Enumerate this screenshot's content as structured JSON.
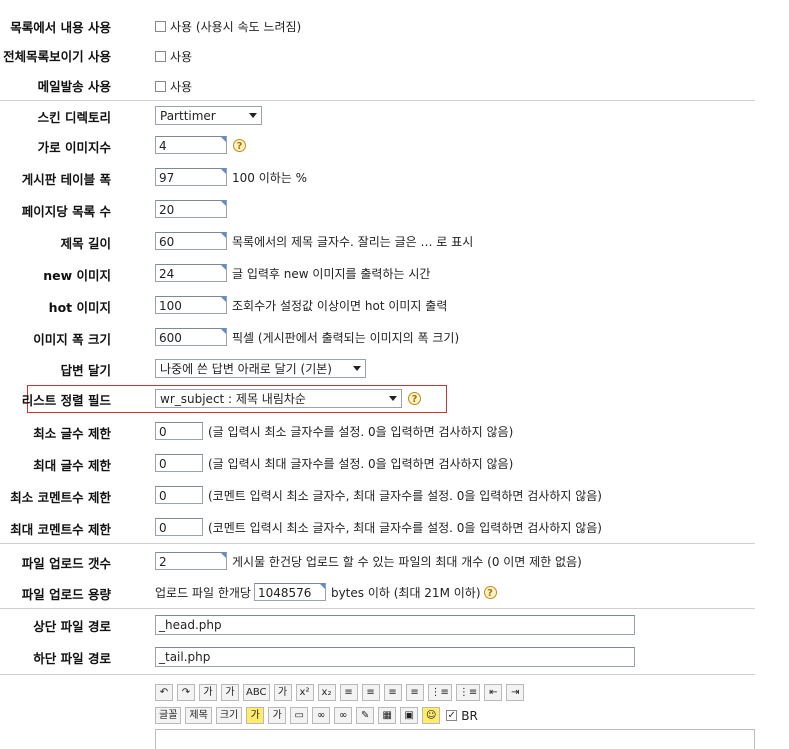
{
  "rows": {
    "list_content": {
      "label": "목록에서 내용 사용",
      "option": "사용 (사용시 속도 느려짐)"
    },
    "full_list": {
      "label": "전체목록보이기 사용",
      "option": "사용"
    },
    "mail_send": {
      "label": "메일발송 사용",
      "option": "사용"
    },
    "skin_dir": {
      "label": "스킨 디렉토리",
      "selected": "Parttimer"
    },
    "horiz_images": {
      "label": "가로 이미지수",
      "value": "4"
    },
    "table_width": {
      "label": "게시판 테이블 폭",
      "value": "97",
      "note": "100 이하는 %"
    },
    "page_rows": {
      "label": "페이지당 목록 수",
      "value": "20"
    },
    "subject_len": {
      "label": "제목 길이",
      "value": "60",
      "note": "목록에서의 제목 글자수. 잘리는 글은 … 로 표시"
    },
    "new_image": {
      "label": "new 이미지",
      "value": "24",
      "note": "글 입력후 new 이미지를 출력하는 시간"
    },
    "hot_image": {
      "label": "hot 이미지",
      "value": "100",
      "note": "조회수가 설정값 이상이면 hot 이미지 출력"
    },
    "image_width": {
      "label": "이미지 폭 크기",
      "value": "600",
      "note": "픽셀 (게시판에서 출력되는 이미지의 폭 크기)"
    },
    "reply_order": {
      "label": "답변 달기",
      "selected": "나중에 쓴 답변 아래로 달기 (기본)"
    },
    "sort_field": {
      "label": "리스트 정렬 필드",
      "selected": "wr_subject : 제목 내림차순"
    },
    "min_chars": {
      "label": "최소 글수 제한",
      "value": "0",
      "note": "(글 입력시 최소 글자수를 설정. 0을 입력하면 검사하지 않음)"
    },
    "max_chars": {
      "label": "최대 글수 제한",
      "value": "0",
      "note": "(글 입력시 최대 글자수를 설정. 0을 입력하면 검사하지 않음)"
    },
    "min_comment": {
      "label": "최소 코멘트수 제한",
      "value": "0",
      "note": "(코멘트 입력시 최소 글자수, 최대 글자수를 설정. 0을 입력하면 검사하지 않음)"
    },
    "max_comment": {
      "label": "최대 코멘트수 제한",
      "value": "0",
      "note": "(코멘트 입력시 최소 글자수, 최대 글자수를 설정. 0을 입력하면 검사하지 않음)"
    },
    "file_count": {
      "label": "파일 업로드 갯수",
      "value": "2",
      "note": "게시물 한건당 업로드 할 수 있는 파일의 최대 개수 (0 이면 제한 없음)"
    },
    "file_size": {
      "label": "파일 업로드 용량",
      "prefix": "업로드 파일 한개당",
      "value": "1048576",
      "note": "bytes 이하 (최대 21M 이하)"
    },
    "head_file": {
      "label": "상단 파일 경로",
      "value": "_head.php"
    },
    "tail_file": {
      "label": "하단 파일 경로",
      "value": "_tail.php"
    }
  },
  "help_glyph": "?",
  "editor": {
    "row1": [
      "↶",
      "↷",
      "가",
      "가",
      "ABC",
      "가",
      "x²",
      "x₂",
      "≡",
      "≡",
      "≡",
      "≡",
      "⋮≡",
      "⋮≡",
      "⇤",
      "⇥"
    ],
    "row2": [
      "글꼴",
      "제목",
      "크기",
      "가",
      "가",
      "▭",
      "∞",
      "∞",
      "✎",
      "▦",
      "▣",
      "☺"
    ],
    "br_label": "BR"
  }
}
